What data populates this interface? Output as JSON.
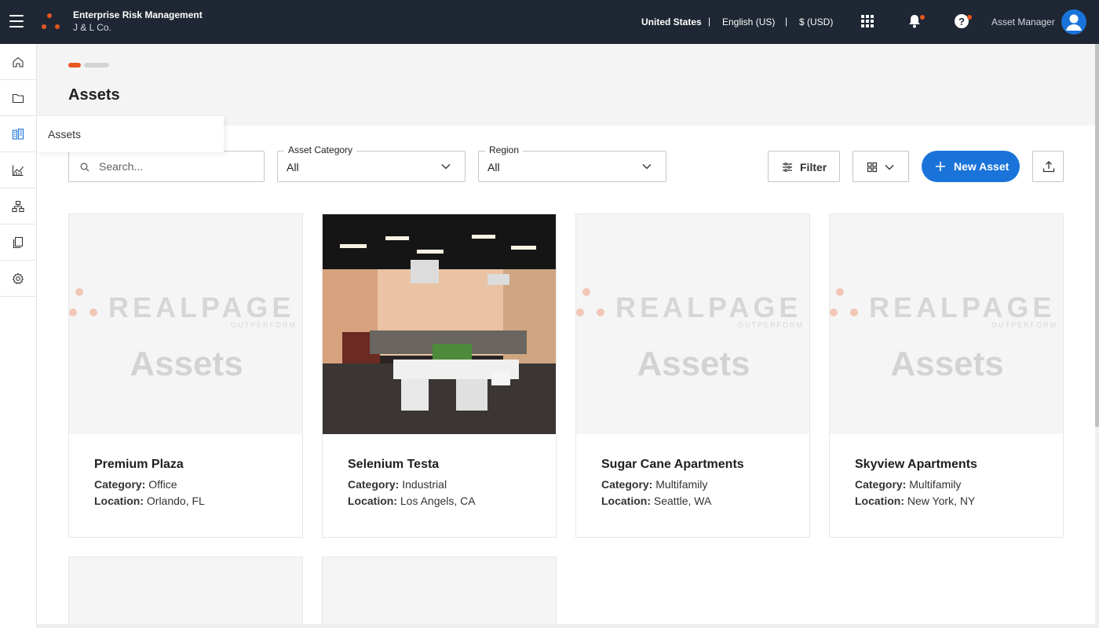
{
  "topbar": {
    "app_title": "Enterprise Risk Management",
    "company": "J & L Co.",
    "country": "United States",
    "separator": "|",
    "language": "English (US)",
    "currency": "$ (USD)",
    "user_label": "Asset Manager",
    "accent_color": "#e8571f"
  },
  "sidenav": {
    "items": [
      "home-icon",
      "folder-icon",
      "assets-icon",
      "chart-icon",
      "hierarchy-icon",
      "documents-icon",
      "settings-icon"
    ],
    "hover_tooltip": "Assets"
  },
  "page": {
    "title": "Assets"
  },
  "toolbar": {
    "search_placeholder": "Search...",
    "category_label": "Asset Category",
    "category_value": "All",
    "region_label": "Region",
    "region_value": "All",
    "filter_label": "Filter",
    "new_asset_label": "New Asset",
    "primary_color": "#1a73d9"
  },
  "placeholder_image": {
    "brand": "REALPAGE",
    "tagline": "OUTPERFORM",
    "caption": "Assets"
  },
  "labels": {
    "category": "Category:",
    "location": "Location:"
  },
  "assets": [
    {
      "name": "Premium Plaza",
      "category": "Office",
      "location": "Orlando, FL",
      "image": "placeholder"
    },
    {
      "name": "Selenium Testa",
      "category": "Industrial",
      "location": "Los Angels, CA",
      "image": "office-photo"
    },
    {
      "name": "Sugar Cane Apartments",
      "category": "Multifamily",
      "location": "Seattle, WA",
      "image": "placeholder"
    },
    {
      "name": "Skyview Apartments",
      "category": "Multifamily",
      "location": "New York, NY",
      "image": "placeholder"
    }
  ]
}
